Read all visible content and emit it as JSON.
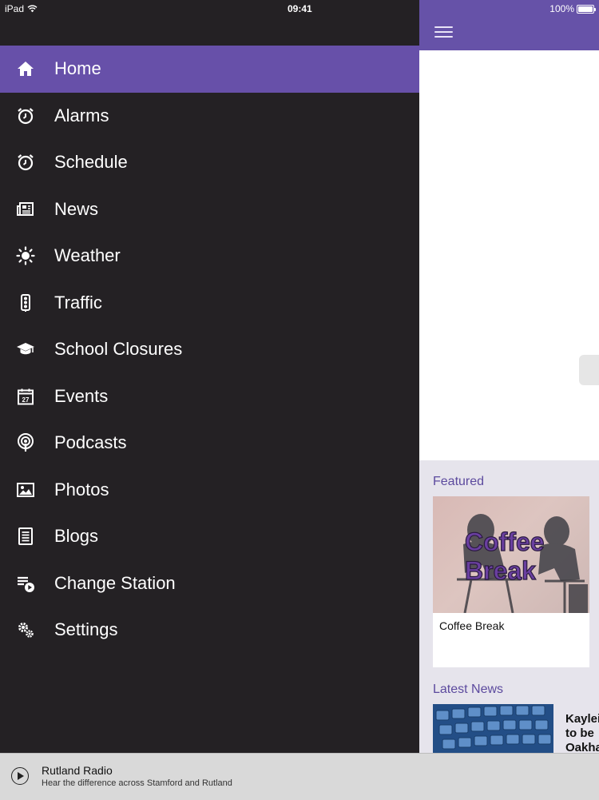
{
  "status_bar": {
    "carrier": "iPad",
    "time": "09:41",
    "battery": "100%"
  },
  "drawer": {
    "items": [
      {
        "label": "Home",
        "icon": "home-icon",
        "active": true
      },
      {
        "label": "Alarms",
        "icon": "alarm-clock-icon"
      },
      {
        "label": "Schedule",
        "icon": "schedule-clock-icon"
      },
      {
        "label": "News",
        "icon": "newspaper-icon"
      },
      {
        "label": "Weather",
        "icon": "sun-icon"
      },
      {
        "label": "Traffic",
        "icon": "traffic-light-icon"
      },
      {
        "label": "School Closures",
        "icon": "graduation-cap-icon"
      },
      {
        "label": "Events",
        "icon": "calendar-icon"
      },
      {
        "label": "Podcasts",
        "icon": "podcast-icon"
      },
      {
        "label": "Photos",
        "icon": "photo-icon"
      },
      {
        "label": "Blogs",
        "icon": "document-icon"
      },
      {
        "label": "Change Station",
        "icon": "playlist-play-icon"
      },
      {
        "label": "Settings",
        "icon": "gears-icon"
      }
    ]
  },
  "main": {
    "featured_title": "Featured",
    "featured_card": {
      "image_text_line1": "Coffee",
      "image_text_line2": "Break",
      "caption": "Coffee Break"
    },
    "latest_news_title": "Latest News",
    "latest_news_snippet": "Kaylei to be Oakha"
  },
  "player": {
    "station": "Rutland Radio",
    "tagline": "Hear the difference across Stamford and Rutland"
  },
  "colors": {
    "accent_purple": "#6652a8",
    "drawer_bg": "#242124",
    "section_title": "#5c4a9e"
  }
}
